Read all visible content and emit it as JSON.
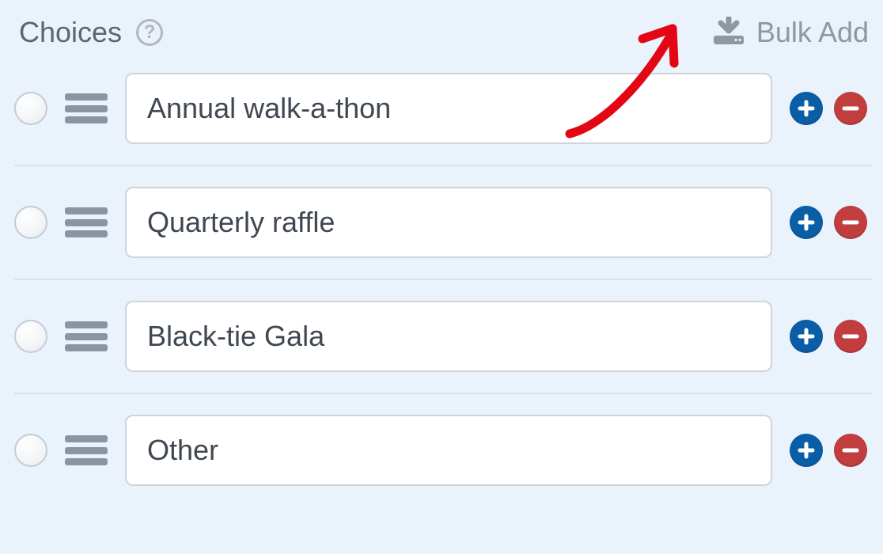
{
  "header": {
    "title": "Choices",
    "help_symbol": "?",
    "bulk_add_label": "Bulk Add"
  },
  "choices": [
    {
      "value": "Annual walk-a-thon"
    },
    {
      "value": "Quarterly raffle"
    },
    {
      "value": "Black-tie Gala"
    },
    {
      "value": "Other"
    }
  ],
  "icons": {
    "download": "download-tray-icon",
    "help": "help-circle-icon",
    "drag": "drag-handle-icon",
    "add": "plus-circle-icon",
    "remove": "minus-circle-icon",
    "radio": "radio-unselected-icon"
  },
  "colors": {
    "background": "#eaf2fb",
    "text_muted": "#5c6670",
    "icon_muted": "#8f98a0",
    "add_button": "#0a5ea8",
    "remove_button": "#c23e3e",
    "annotation_arrow": "#e30613"
  }
}
